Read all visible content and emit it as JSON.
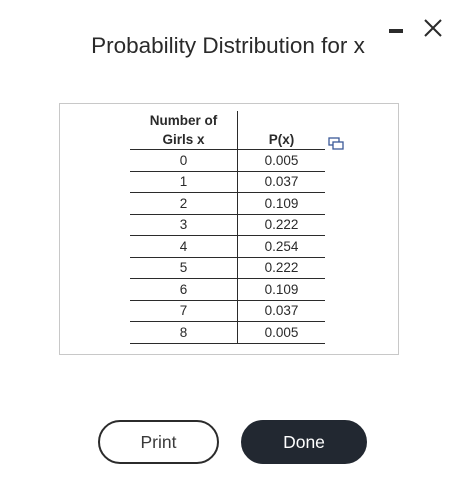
{
  "window": {
    "title": "Probability Distribution for x"
  },
  "table": {
    "headers": {
      "x_line1": "Number of",
      "x_line2": "Girls x",
      "p": "P(x)"
    },
    "rows": [
      {
        "x": "0",
        "p": "0.005"
      },
      {
        "x": "1",
        "p": "0.037"
      },
      {
        "x": "2",
        "p": "0.109"
      },
      {
        "x": "3",
        "p": "0.222"
      },
      {
        "x": "4",
        "p": "0.254"
      },
      {
        "x": "5",
        "p": "0.222"
      },
      {
        "x": "6",
        "p": "0.109"
      },
      {
        "x": "7",
        "p": "0.037"
      },
      {
        "x": "8",
        "p": "0.005"
      }
    ]
  },
  "buttons": {
    "print_label": "Print",
    "done_label": "Done"
  },
  "icons": {
    "minimize": "minimize-icon",
    "close": "close-icon",
    "copy": "copy-icon"
  },
  "colors": {
    "done_bg": "#222831",
    "text": "#2a2a2a",
    "frame_border": "#c8c8c8"
  }
}
